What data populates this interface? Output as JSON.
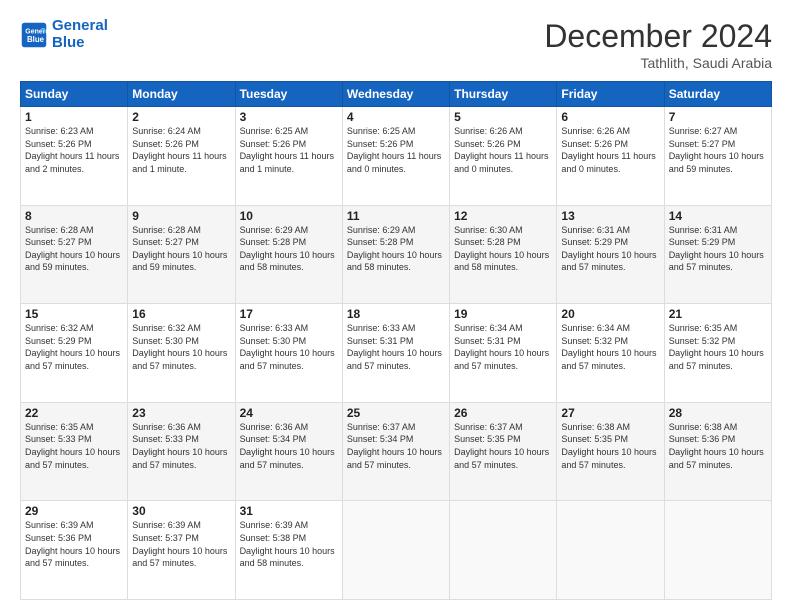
{
  "header": {
    "logo_line1": "General",
    "logo_line2": "Blue",
    "month": "December 2024",
    "location": "Tathlith, Saudi Arabia"
  },
  "days_of_week": [
    "Sunday",
    "Monday",
    "Tuesday",
    "Wednesday",
    "Thursday",
    "Friday",
    "Saturday"
  ],
  "weeks": [
    [
      {
        "day": "1",
        "sunrise": "6:23 AM",
        "sunset": "5:26 PM",
        "daylight": "11 hours and 2 minutes."
      },
      {
        "day": "2",
        "sunrise": "6:24 AM",
        "sunset": "5:26 PM",
        "daylight": "11 hours and 1 minute."
      },
      {
        "day": "3",
        "sunrise": "6:25 AM",
        "sunset": "5:26 PM",
        "daylight": "11 hours and 1 minute."
      },
      {
        "day": "4",
        "sunrise": "6:25 AM",
        "sunset": "5:26 PM",
        "daylight": "11 hours and 0 minutes."
      },
      {
        "day": "5",
        "sunrise": "6:26 AM",
        "sunset": "5:26 PM",
        "daylight": "11 hours and 0 minutes."
      },
      {
        "day": "6",
        "sunrise": "6:26 AM",
        "sunset": "5:26 PM",
        "daylight": "11 hours and 0 minutes."
      },
      {
        "day": "7",
        "sunrise": "6:27 AM",
        "sunset": "5:27 PM",
        "daylight": "10 hours and 59 minutes."
      }
    ],
    [
      {
        "day": "8",
        "sunrise": "6:28 AM",
        "sunset": "5:27 PM",
        "daylight": "10 hours and 59 minutes."
      },
      {
        "day": "9",
        "sunrise": "6:28 AM",
        "sunset": "5:27 PM",
        "daylight": "10 hours and 59 minutes."
      },
      {
        "day": "10",
        "sunrise": "6:29 AM",
        "sunset": "5:28 PM",
        "daylight": "10 hours and 58 minutes."
      },
      {
        "day": "11",
        "sunrise": "6:29 AM",
        "sunset": "5:28 PM",
        "daylight": "10 hours and 58 minutes."
      },
      {
        "day": "12",
        "sunrise": "6:30 AM",
        "sunset": "5:28 PM",
        "daylight": "10 hours and 58 minutes."
      },
      {
        "day": "13",
        "sunrise": "6:31 AM",
        "sunset": "5:29 PM",
        "daylight": "10 hours and 57 minutes."
      },
      {
        "day": "14",
        "sunrise": "6:31 AM",
        "sunset": "5:29 PM",
        "daylight": "10 hours and 57 minutes."
      }
    ],
    [
      {
        "day": "15",
        "sunrise": "6:32 AM",
        "sunset": "5:29 PM",
        "daylight": "10 hours and 57 minutes."
      },
      {
        "day": "16",
        "sunrise": "6:32 AM",
        "sunset": "5:30 PM",
        "daylight": "10 hours and 57 minutes."
      },
      {
        "day": "17",
        "sunrise": "6:33 AM",
        "sunset": "5:30 PM",
        "daylight": "10 hours and 57 minutes."
      },
      {
        "day": "18",
        "sunrise": "6:33 AM",
        "sunset": "5:31 PM",
        "daylight": "10 hours and 57 minutes."
      },
      {
        "day": "19",
        "sunrise": "6:34 AM",
        "sunset": "5:31 PM",
        "daylight": "10 hours and 57 minutes."
      },
      {
        "day": "20",
        "sunrise": "6:34 AM",
        "sunset": "5:32 PM",
        "daylight": "10 hours and 57 minutes."
      },
      {
        "day": "21",
        "sunrise": "6:35 AM",
        "sunset": "5:32 PM",
        "daylight": "10 hours and 57 minutes."
      }
    ],
    [
      {
        "day": "22",
        "sunrise": "6:35 AM",
        "sunset": "5:33 PM",
        "daylight": "10 hours and 57 minutes."
      },
      {
        "day": "23",
        "sunrise": "6:36 AM",
        "sunset": "5:33 PM",
        "daylight": "10 hours and 57 minutes."
      },
      {
        "day": "24",
        "sunrise": "6:36 AM",
        "sunset": "5:34 PM",
        "daylight": "10 hours and 57 minutes."
      },
      {
        "day": "25",
        "sunrise": "6:37 AM",
        "sunset": "5:34 PM",
        "daylight": "10 hours and 57 minutes."
      },
      {
        "day": "26",
        "sunrise": "6:37 AM",
        "sunset": "5:35 PM",
        "daylight": "10 hours and 57 minutes."
      },
      {
        "day": "27",
        "sunrise": "6:38 AM",
        "sunset": "5:35 PM",
        "daylight": "10 hours and 57 minutes."
      },
      {
        "day": "28",
        "sunrise": "6:38 AM",
        "sunset": "5:36 PM",
        "daylight": "10 hours and 57 minutes."
      }
    ],
    [
      {
        "day": "29",
        "sunrise": "6:39 AM",
        "sunset": "5:36 PM",
        "daylight": "10 hours and 57 minutes."
      },
      {
        "day": "30",
        "sunrise": "6:39 AM",
        "sunset": "5:37 PM",
        "daylight": "10 hours and 57 minutes."
      },
      {
        "day": "31",
        "sunrise": "6:39 AM",
        "sunset": "5:38 PM",
        "daylight": "10 hours and 58 minutes."
      },
      null,
      null,
      null,
      null
    ]
  ]
}
